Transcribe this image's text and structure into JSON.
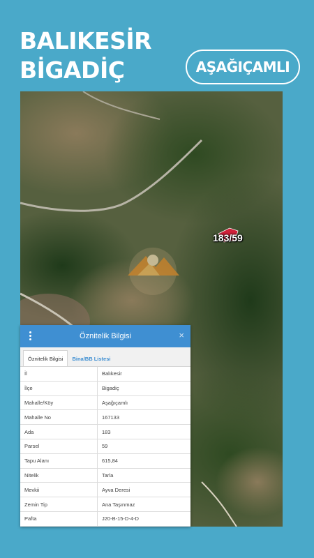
{
  "header": {
    "title_line1": "BALIKESİR",
    "title_line2": "BİGADİÇ",
    "badge": "AŞAĞIÇAMLI"
  },
  "map": {
    "parcel_label": "183/59",
    "parcel_color": "#d0213a"
  },
  "panel": {
    "title": "Öznitelik Bilgisi",
    "close_symbol": "×",
    "tabs": [
      "Öznitelik Bilgisi",
      "Bina/BB Listesi"
    ],
    "rows": [
      {
        "key": "İl",
        "value": "Balıkesir"
      },
      {
        "key": "İlçe",
        "value": "Bigadiç"
      },
      {
        "key": "Mahalle/Köy",
        "value": "Aşağıçamlı"
      },
      {
        "key": "Mahalle No",
        "value": "167133"
      },
      {
        "key": "Ada",
        "value": "183"
      },
      {
        "key": "Parsel",
        "value": "59"
      },
      {
        "key": "Tapu Alanı",
        "value": "615,84"
      },
      {
        "key": "Nitelik",
        "value": "Tarla"
      },
      {
        "key": "Mevkii",
        "value": "Ayva Deresi"
      },
      {
        "key": "Zemin Tip",
        "value": "Ana Taşınmaz"
      },
      {
        "key": "Pafta",
        "value": "J20-B-15-D-4-D"
      }
    ]
  },
  "colors": {
    "background": "#4aa9c9",
    "panel_header": "#3f8fd2"
  }
}
